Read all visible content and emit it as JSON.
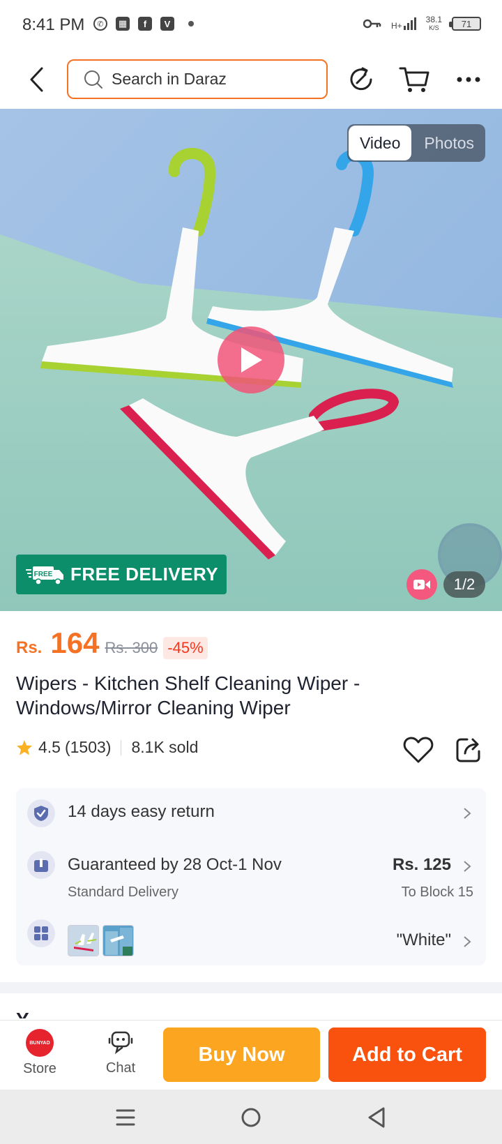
{
  "status_bar": {
    "time": "8:41 PM",
    "network_speed": "38.1",
    "network_unit": "K/S",
    "network_type": "H+",
    "battery": "71",
    "icons": [
      "whatsapp-icon",
      "app-icon",
      "facebook-icon",
      "v-app-icon",
      "key-icon",
      "signal-icon",
      "battery-icon"
    ]
  },
  "header": {
    "search_placeholder": "Search in Daraz",
    "icons": [
      "back-icon",
      "search-icon",
      "history-icon",
      "cart-icon",
      "more-icon"
    ]
  },
  "gallery": {
    "tabs": [
      "Video",
      "Photos"
    ],
    "active_tab": "Video",
    "badge": "FREE DELIVERY",
    "badge_icon_text": "FREE",
    "page_indicator": "1/2"
  },
  "product": {
    "currency": "Rs.",
    "price": "164",
    "original_price": "Rs. 300",
    "discount": "-45%",
    "title": "Wipers - Kitchen Shelf Cleaning Wiper - Windows/Mirror Cleaning Wiper",
    "rating": "4.5",
    "rating_count": "(1503)",
    "sold": "8.1K sold"
  },
  "services": {
    "return_policy": "14 days easy return",
    "delivery_guarantee": "Guaranteed by 28 Oct-1 Nov",
    "delivery_type": "Standard Delivery",
    "delivery_fee": "Rs. 125",
    "delivery_location": "To Block 15",
    "variant": "\"White\""
  },
  "section_peek": "Y",
  "bottom_bar": {
    "store_label": "Store",
    "store_logo_text": "BUNYAD",
    "chat_label": "Chat",
    "buy_now": "Buy Now",
    "add_to_cart": "Add to Cart"
  },
  "colors": {
    "accent": "#f57224",
    "buy_now": "#fca520",
    "add_to_cart": "#f8520e",
    "free_delivery": "#0c8e6a"
  }
}
